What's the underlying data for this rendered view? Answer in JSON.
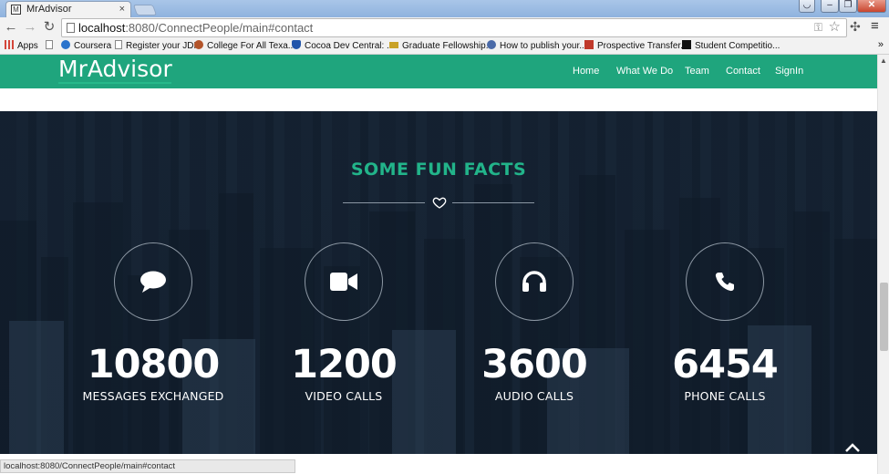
{
  "browser": {
    "tab_title": "MrAdvisor",
    "tab_close": "×",
    "url_host": "localhost",
    "url_path": ":8080/ConnectPeople/main#contact",
    "window_buttons": {
      "minimize": "–",
      "maximize": "❐",
      "close": "✕"
    },
    "nav_icons": {
      "back": "←",
      "forward": "→",
      "reload": "↻",
      "menu": "≡",
      "more": "»"
    }
  },
  "bookmarks": [
    {
      "label": "Apps",
      "icon": "apps-grid-icon",
      "color": "#d4463a"
    },
    {
      "label": "",
      "icon": "page-icon",
      "color": "#888888"
    },
    {
      "label": "Coursera",
      "icon": "coursera-icon",
      "color": "#2a73cc"
    },
    {
      "label": "Register your JDK",
      "icon": "page-icon",
      "color": "#888888"
    },
    {
      "label": "College For All Texa...",
      "icon": "star-seal-icon",
      "color": "#b3542a"
    },
    {
      "label": "Cocoa Dev Central: ...",
      "icon": "shield-icon",
      "color": "#2255aa"
    },
    {
      "label": "Graduate Fellowship...",
      "icon": "badge-icon",
      "color": "#c9a227"
    },
    {
      "label": "How to publish your...",
      "icon": "globe-icon",
      "color": "#4a6aa8"
    },
    {
      "label": "Prospective Transfer...",
      "icon": "document-icon",
      "color": "#c0392b"
    },
    {
      "label": "Student Competitio...",
      "icon": "square-icon",
      "color": "#111111"
    }
  ],
  "site": {
    "brand": "MrAdvisor",
    "nav": [
      "Home",
      "What We Do",
      "Team",
      "Contact",
      "SignIn"
    ],
    "accent_color": "#1fa57d"
  },
  "facts_section": {
    "title": "SOME FUN FACTS",
    "items": [
      {
        "icon": "chat-bubble-icon",
        "number": "10800",
        "label": "MESSAGES EXCHANGED"
      },
      {
        "icon": "video-camera-icon",
        "number": "1200",
        "label": "VIDEO CALLS"
      },
      {
        "icon": "headphones-icon",
        "number": "3600",
        "label": "AUDIO CALLS"
      },
      {
        "icon": "phone-icon",
        "number": "6454",
        "label": "PHONE CALLS"
      }
    ]
  },
  "status_bar": {
    "text": "localhost:8080/ConnectPeople/main#contact"
  }
}
